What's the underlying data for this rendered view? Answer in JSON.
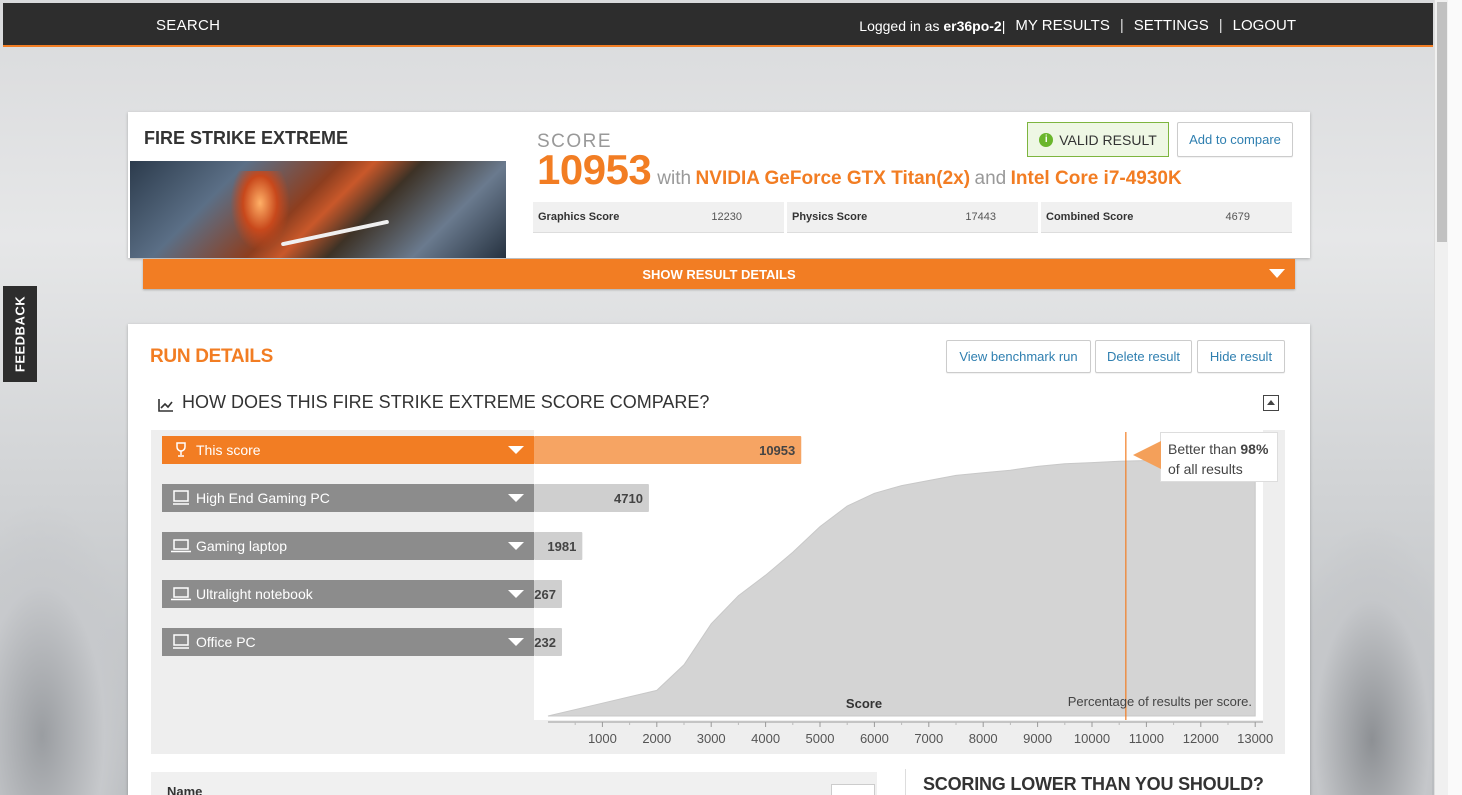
{
  "topbar": {
    "search": "SEARCH",
    "login_prefix": "Logged in as",
    "username": "er36po-2",
    "sep": "|",
    "my_results": "MY RESULTS",
    "settings": "SETTINGS",
    "logout": "LOGOUT"
  },
  "feedback": "FEEDBACK",
  "result": {
    "test_name": "FIRE STRIKE EXTREME",
    "score_label": "SCORE",
    "score": "10953",
    "with": "with",
    "gpu": "NVIDIA GeForce GTX Titan(2x)",
    "and": "and",
    "cpu": "Intel Core i7-4930K",
    "valid": "VALID RESULT",
    "add_compare": "Add to compare",
    "subscores": [
      {
        "label": "Graphics Score",
        "value": "12230"
      },
      {
        "label": "Physics Score",
        "value": "17443"
      },
      {
        "label": "Combined Score",
        "value": "4679"
      }
    ],
    "show_details": "SHOW RESULT DETAILS"
  },
  "run": {
    "title": "RUN DETAILS",
    "view_run": "View benchmark run",
    "delete": "Delete result",
    "hide": "Hide result",
    "compare_heading": "HOW DOES THIS FIRE STRIKE EXTREME SCORE COMPARE?",
    "tooltip_prefix": "Better than",
    "tooltip_pct": "98%",
    "tooltip_suffix": "of all results",
    "name_label": "Name",
    "lower_heading": "SCORING LOWER THAN YOU SHOULD?"
  },
  "colors": {
    "accent": "#f27d23",
    "this_bar": "#f6a463",
    "grey_label": "#8c8c8c",
    "grey_bar": "#cfcfcf"
  },
  "chart_data": {
    "type": "bar",
    "categories": [
      "This score",
      "High End Gaming PC",
      "Gaming laptop",
      "Ultralight notebook",
      "Office PC"
    ],
    "icons": [
      "trophy-icon",
      "desktop-icon",
      "laptop-icon",
      "laptop-icon",
      "desktop-icon"
    ],
    "values": [
      10953,
      4710,
      1981,
      267,
      232
    ],
    "highlight_index": 0,
    "xlabel": "Score",
    "distribution_caption": "Percentage of results per score.",
    "xticks": [
      1000,
      2000,
      3000,
      4000,
      5000,
      6000,
      7000,
      8000,
      9000,
      10000,
      11000,
      12000,
      13000
    ],
    "xlim": [
      0,
      13400
    ],
    "distribution": [
      [
        0,
        0.0
      ],
      [
        1000,
        0.05
      ],
      [
        2000,
        0.1
      ],
      [
        2500,
        0.2
      ],
      [
        3000,
        0.36
      ],
      [
        3500,
        0.47
      ],
      [
        4000,
        0.55
      ],
      [
        4500,
        0.64
      ],
      [
        5000,
        0.74
      ],
      [
        5500,
        0.82
      ],
      [
        6000,
        0.87
      ],
      [
        6500,
        0.9
      ],
      [
        7000,
        0.92
      ],
      [
        7500,
        0.94
      ],
      [
        8000,
        0.95
      ],
      [
        8500,
        0.96
      ],
      [
        9000,
        0.975
      ],
      [
        9500,
        0.985
      ],
      [
        10000,
        0.99
      ],
      [
        10500,
        0.995
      ],
      [
        11000,
        0.998
      ],
      [
        12000,
        1.0
      ],
      [
        13000,
        1.0
      ]
    ]
  }
}
